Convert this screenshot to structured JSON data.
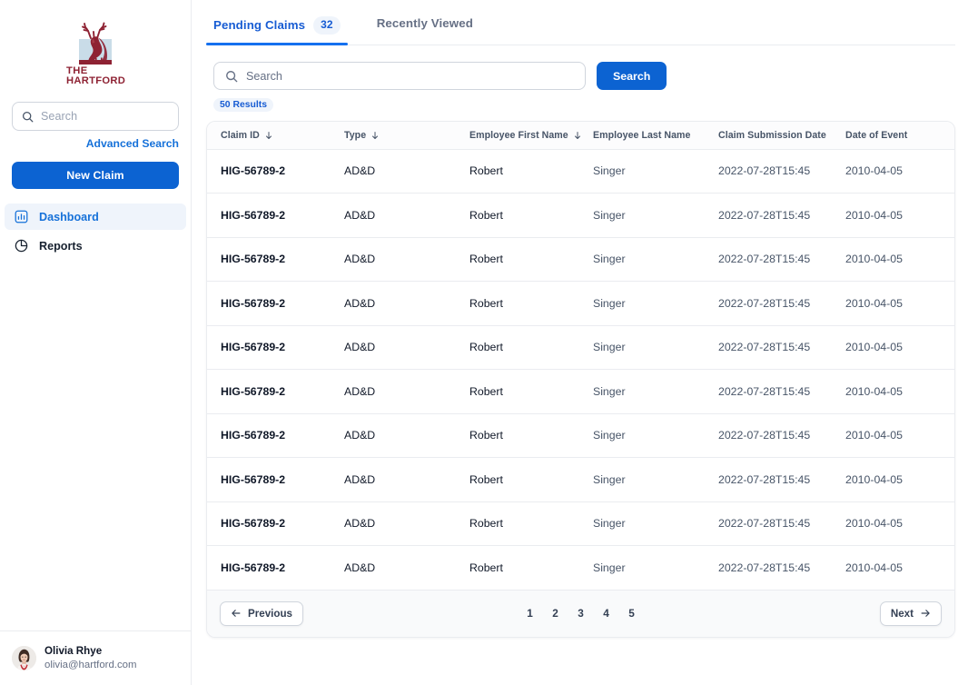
{
  "brand": {
    "logo_line1": "THE",
    "logo_line2": "HARTFORD",
    "logo_color": "#8E2233",
    "accent_blue": "#0C63D2",
    "link_blue": "#1671D9"
  },
  "sidebar": {
    "search": {
      "placeholder": "Search",
      "value": "",
      "icon": "search-icon"
    },
    "advanced_search_label": "Advanced Search",
    "new_claim_label": "New Claim",
    "nav_items": [
      {
        "label": "Dashboard",
        "icon": "bar-chart-icon",
        "active": true
      },
      {
        "label": "Reports",
        "icon": "pie-chart-icon",
        "active": false
      }
    ],
    "profile": {
      "name": "Olivia Rhye",
      "email": "olivia@hartford.com",
      "avatar": "user-avatar"
    }
  },
  "main": {
    "tabs": [
      {
        "label": "Pending Claims",
        "badge": "32",
        "active": true
      },
      {
        "label": "Recently Viewed",
        "badge": "",
        "active": false
      }
    ],
    "search": {
      "placeholder": "Search",
      "value": "",
      "icon": "search-icon"
    },
    "search_button_label": "Search",
    "results_label": "50 Results",
    "table": {
      "columns": [
        {
          "label": "Claim ID",
          "sortable": true
        },
        {
          "label": "Type",
          "sortable": true
        },
        {
          "label": "Employee First Name",
          "sortable": true
        },
        {
          "label": "Employee Last Name",
          "sortable": false
        },
        {
          "label": "Claim Submission Date",
          "sortable": false
        },
        {
          "label": "Date of Event",
          "sortable": false
        }
      ],
      "rows": [
        {
          "claim_id": "HIG-56789-2",
          "type": "AD&D",
          "first_name": "Robert",
          "last_name": "Singer",
          "submission_date": "2022-07-28T15:45",
          "event_date": "2010-04-05"
        },
        {
          "claim_id": "HIG-56789-2",
          "type": "AD&D",
          "first_name": "Robert",
          "last_name": "Singer",
          "submission_date": "2022-07-28T15:45",
          "event_date": "2010-04-05"
        },
        {
          "claim_id": "HIG-56789-2",
          "type": "AD&D",
          "first_name": "Robert",
          "last_name": "Singer",
          "submission_date": "2022-07-28T15:45",
          "event_date": "2010-04-05"
        },
        {
          "claim_id": "HIG-56789-2",
          "type": "AD&D",
          "first_name": "Robert",
          "last_name": "Singer",
          "submission_date": "2022-07-28T15:45",
          "event_date": "2010-04-05"
        },
        {
          "claim_id": "HIG-56789-2",
          "type": "AD&D",
          "first_name": "Robert",
          "last_name": "Singer",
          "submission_date": "2022-07-28T15:45",
          "event_date": "2010-04-05"
        },
        {
          "claim_id": "HIG-56789-2",
          "type": "AD&D",
          "first_name": "Robert",
          "last_name": "Singer",
          "submission_date": "2022-07-28T15:45",
          "event_date": "2010-04-05"
        },
        {
          "claim_id": "HIG-56789-2",
          "type": "AD&D",
          "first_name": "Robert",
          "last_name": "Singer",
          "submission_date": "2022-07-28T15:45",
          "event_date": "2010-04-05"
        },
        {
          "claim_id": "HIG-56789-2",
          "type": "AD&D",
          "first_name": "Robert",
          "last_name": "Singer",
          "submission_date": "2022-07-28T15:45",
          "event_date": "2010-04-05"
        },
        {
          "claim_id": "HIG-56789-2",
          "type": "AD&D",
          "first_name": "Robert",
          "last_name": "Singer",
          "submission_date": "2022-07-28T15:45",
          "event_date": "2010-04-05"
        },
        {
          "claim_id": "HIG-56789-2",
          "type": "AD&D",
          "first_name": "Robert",
          "last_name": "Singer",
          "submission_date": "2022-07-28T15:45",
          "event_date": "2010-04-05"
        }
      ]
    },
    "pagination": {
      "previous_label": "Previous",
      "next_label": "Next",
      "pages": [
        "1",
        "2",
        "3",
        "4",
        "5"
      ],
      "current_page": "1"
    }
  }
}
